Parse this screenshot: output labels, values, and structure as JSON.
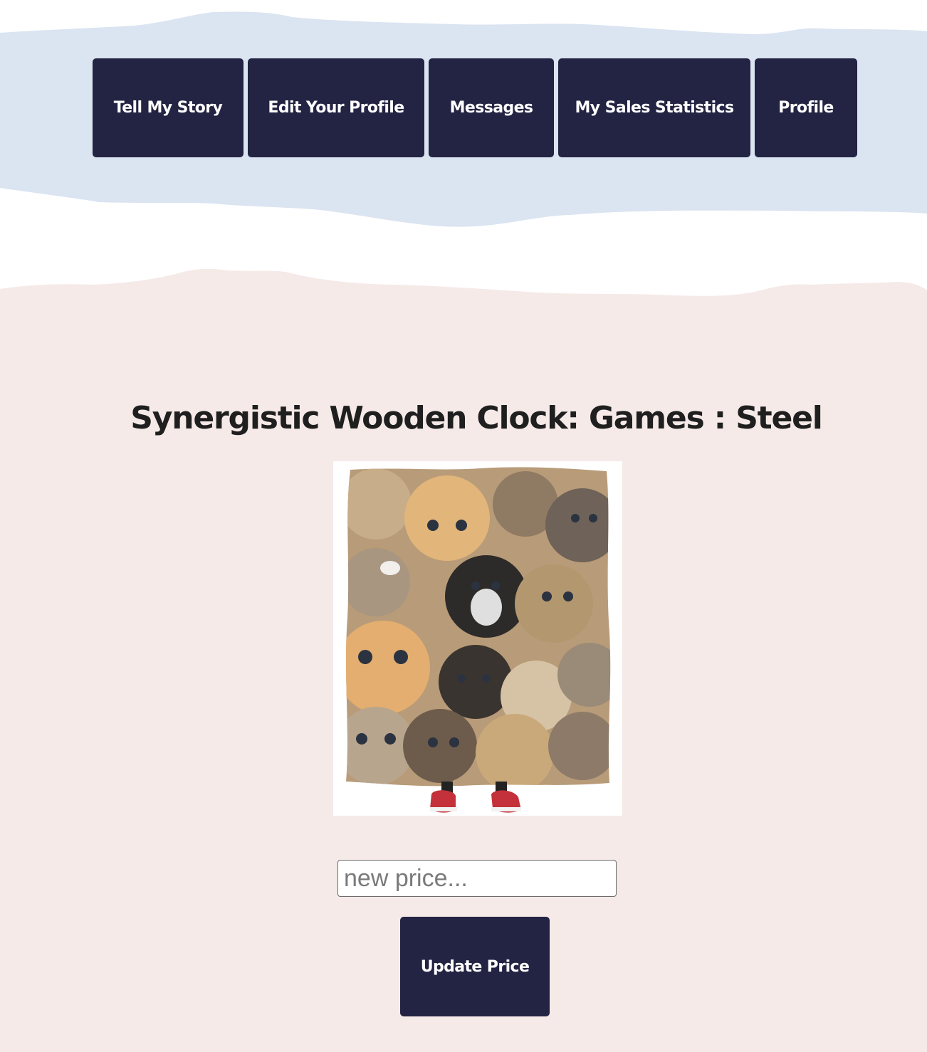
{
  "colors": {
    "header_band": "#dbe4f1",
    "content_band": "#f5eae8",
    "button_bg": "#232343",
    "button_text": "#ffffff",
    "title_text": "#1f1f1f"
  },
  "nav": {
    "items": [
      {
        "label": "Tell My Story"
      },
      {
        "label": "Edit Your Profile"
      },
      {
        "label": "Messages"
      },
      {
        "label": "My Sales Statistics"
      },
      {
        "label": "Profile"
      }
    ]
  },
  "product": {
    "title": "Synergistic Wooden Clock: Games : Steel",
    "image_icon": "cat-collage-blanket-image"
  },
  "price_form": {
    "placeholder": "new price...",
    "value": "",
    "submit_label": "Update Price"
  }
}
